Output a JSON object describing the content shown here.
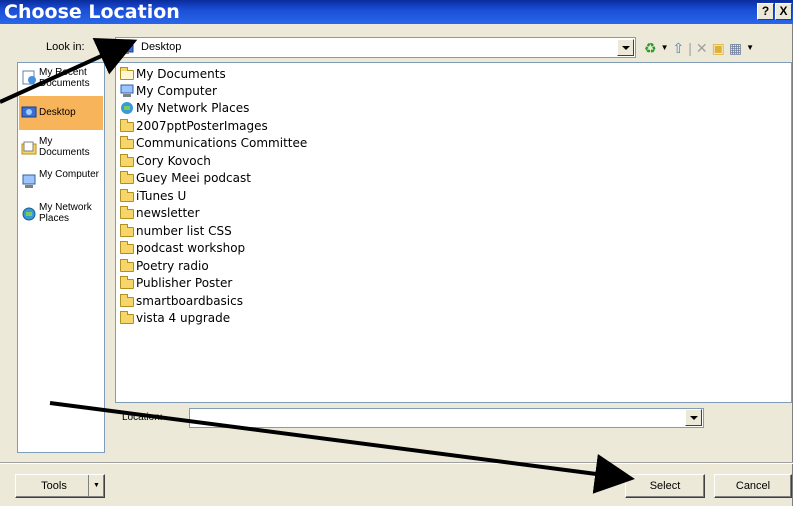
{
  "window": {
    "title": "Choose Location",
    "help_label": "?",
    "close_label": "X"
  },
  "lookin": {
    "label": "Look in:",
    "value": "Desktop"
  },
  "toolbar": {
    "icons": [
      "back-icon",
      "up-folder-icon",
      "delete-icon",
      "new-folder-icon",
      "views-icon"
    ]
  },
  "places": [
    {
      "label": "My Recent Documents",
      "icon": "recent-documents-icon",
      "selected": false
    },
    {
      "label": "Desktop",
      "icon": "desktop-icon",
      "selected": true
    },
    {
      "label": "My Documents",
      "icon": "my-documents-icon",
      "selected": false
    },
    {
      "label": "My Computer",
      "icon": "my-computer-icon",
      "selected": false
    },
    {
      "label": "My Network Places",
      "icon": "network-places-icon",
      "selected": false
    }
  ],
  "files": [
    {
      "name": "My Documents",
      "icon": "my-documents-icon"
    },
    {
      "name": "My Computer",
      "icon": "my-computer-icon"
    },
    {
      "name": "My Network Places",
      "icon": "network-places-icon"
    },
    {
      "name": "2007pptPosterImages",
      "icon": "folder-icon"
    },
    {
      "name": "Communications Committee",
      "icon": "folder-icon"
    },
    {
      "name": "Cory Kovoch",
      "icon": "folder-icon"
    },
    {
      "name": "Guey Meei podcast",
      "icon": "folder-icon"
    },
    {
      "name": "iTunes U",
      "icon": "folder-icon"
    },
    {
      "name": "newsletter",
      "icon": "folder-icon"
    },
    {
      "name": "number list CSS",
      "icon": "folder-icon"
    },
    {
      "name": "podcast workshop",
      "icon": "folder-icon"
    },
    {
      "name": "Poetry radio",
      "icon": "folder-icon"
    },
    {
      "name": "Publisher Poster",
      "icon": "folder-icon"
    },
    {
      "name": "smartboardbasics",
      "icon": "folder-icon"
    },
    {
      "name": "vista 4 upgrade",
      "icon": "folder-icon"
    }
  ],
  "location": {
    "label": "Location:",
    "value": ""
  },
  "buttons": {
    "tools": "Tools",
    "select": "Select",
    "cancel": "Cancel"
  },
  "colors": {
    "titlebar": "#0a2c9c",
    "selected_place": "#f8b45a",
    "dialog_bg": "#ece9d8"
  }
}
